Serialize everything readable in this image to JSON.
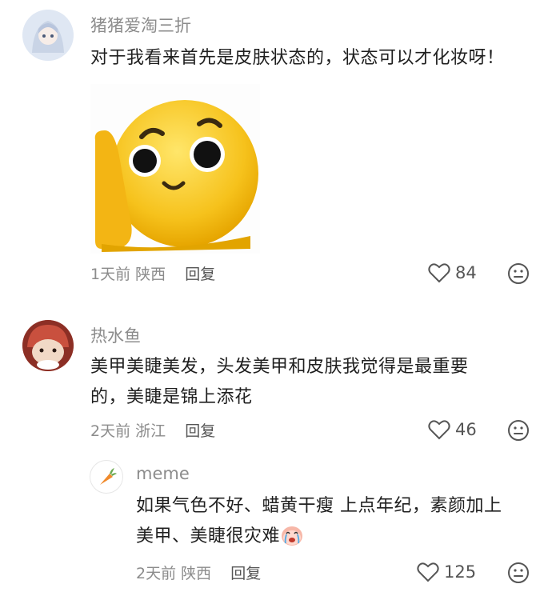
{
  "comments": [
    {
      "username": "猪猪爱淘三折",
      "text": "对于我看来首先是皮肤状态的，状态可以才化妆呀！",
      "time": "1天前",
      "location": "陕西",
      "reply_label": "回复",
      "likes": "84",
      "sticker_icon": "surprised-emoji-sticker"
    },
    {
      "username": "热水鱼",
      "text_line1": "美甲美睫美发，头发美甲和皮肤我觉得是最重要",
      "text_line2": "的，美睫是锦上添花",
      "time": "2天前",
      "location": "浙江",
      "reply_label": "回复",
      "likes": "46"
    }
  ],
  "reply": {
    "username": "meme",
    "text_line1": "如果气色不好、蜡黄干瘦 上点年纪，素颜加上",
    "text_line2": "美甲、美睫很灾难",
    "time": "2天前",
    "location": "陕西",
    "reply_label": "回复",
    "likes": "125",
    "inline_icon": "crying-face-emoji"
  },
  "colors": {
    "meta_text": "#8c8c8c",
    "body_text": "#1f1f1f",
    "sticker_yellow": "#f6c21c"
  }
}
